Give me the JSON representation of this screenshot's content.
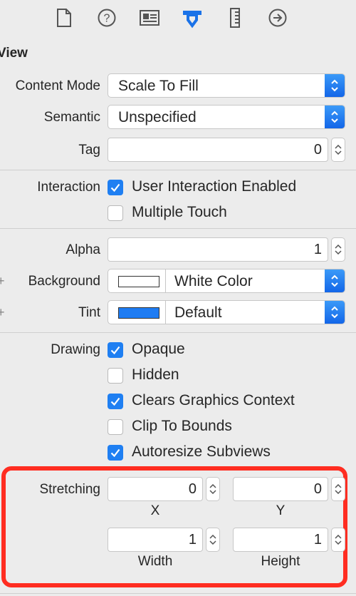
{
  "toolbar": {
    "icons": [
      "file-inspector-icon",
      "quick-help-icon",
      "identity-inspector-icon",
      "attributes-inspector-icon",
      "size-inspector-icon",
      "connections-inspector-icon"
    ]
  },
  "section": {
    "title": "View"
  },
  "content_mode": {
    "label": "Content Mode",
    "value": "Scale To Fill"
  },
  "semantic": {
    "label": "Semantic",
    "value": "Unspecified"
  },
  "tag": {
    "label": "Tag",
    "value": "0"
  },
  "interaction": {
    "label": "Interaction",
    "user_interaction": {
      "label": "User Interaction Enabled",
      "checked": true
    },
    "multiple_touch": {
      "label": "Multiple Touch",
      "checked": false
    }
  },
  "alpha": {
    "label": "Alpha",
    "value": "1"
  },
  "background": {
    "label": "Background",
    "value": "White Color",
    "swatch": "#ffffff"
  },
  "tint": {
    "label": "Tint",
    "value": "Default",
    "swatch": "#1e7cf3"
  },
  "drawing": {
    "label": "Drawing",
    "opaque": {
      "label": "Opaque",
      "checked": true
    },
    "hidden": {
      "label": "Hidden",
      "checked": false
    },
    "clears": {
      "label": "Clears Graphics Context",
      "checked": true
    },
    "clip": {
      "label": "Clip To Bounds",
      "checked": false
    },
    "autoresize": {
      "label": "Autoresize Subviews",
      "checked": true
    }
  },
  "stretching": {
    "label": "Stretching",
    "x": {
      "value": "0",
      "caption": "X"
    },
    "y": {
      "value": "0",
      "caption": "Y"
    },
    "width": {
      "value": "1",
      "caption": "Width"
    },
    "height": {
      "value": "1",
      "caption": "Height"
    }
  },
  "colors": {
    "accent": "#1f7ff2",
    "highlight": "#ff2d21"
  }
}
